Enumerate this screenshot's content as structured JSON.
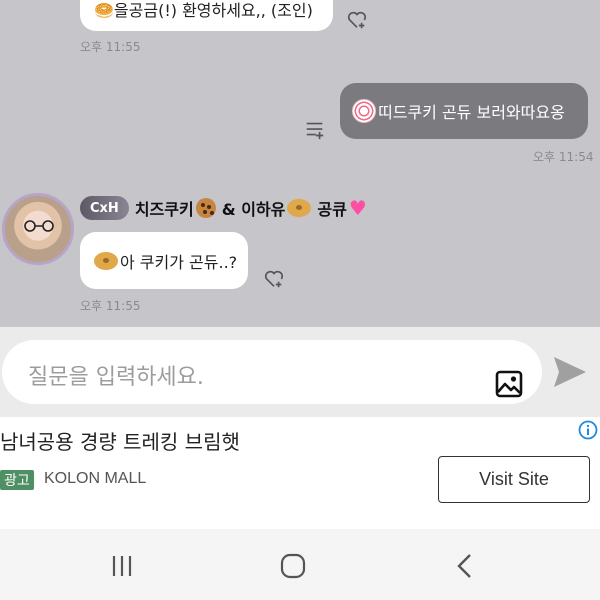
{
  "messages": {
    "top_partial": {
      "text": "🥯을공금(!) 환영하세요,, (조인)",
      "time": "오후 11:55"
    },
    "mine": {
      "text": "띠드쿠키 곤듀 보러와따요옹",
      "time": "오후 11:54"
    },
    "other": {
      "badge": "CxH",
      "sender_part1": "치즈쿠키",
      "sender_part2": "& 이하유",
      "sender_part3": "공큐",
      "text": "아 쿠키가 곤듀..?",
      "time": "오후 11:55"
    }
  },
  "input": {
    "placeholder": "질문을 입력하세요."
  },
  "ad": {
    "title": "남녀공용 경량 트레킹 브림햇",
    "tag": "광고",
    "brand": "KOLON MALL",
    "button": "Visit Site"
  },
  "icons": {
    "react": "heart-add-icon",
    "add_list": "add-list-icon",
    "image": "image-icon",
    "send": "send-icon",
    "info": "info-icon",
    "nav_recents": "recents-icon",
    "nav_home": "home-icon",
    "nav_back": "back-icon"
  },
  "colors": {
    "chat_bg": "#c6c5ca",
    "my_bubble": "#7b7b7f",
    "ad_tag": "#4e8f63",
    "info": "#1a8be0",
    "heart": "#ff4fa3"
  }
}
